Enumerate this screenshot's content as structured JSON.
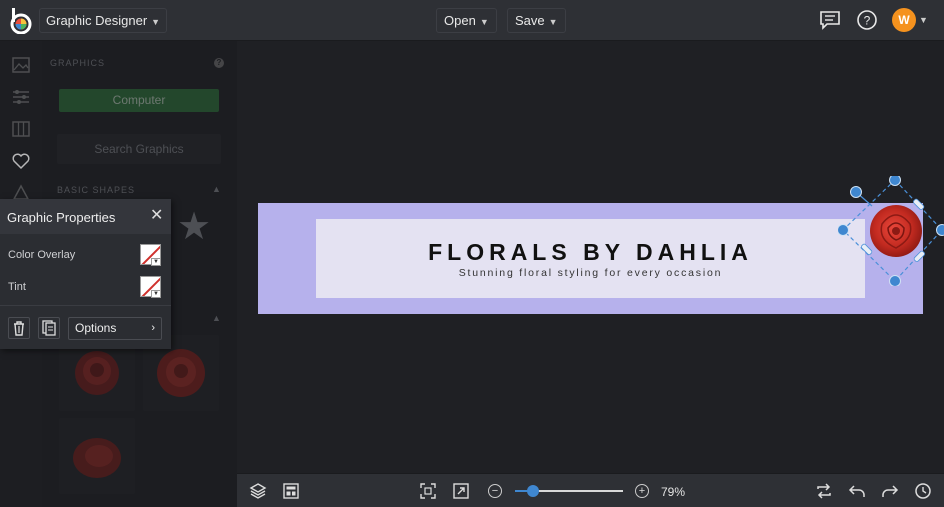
{
  "topbar": {
    "app_name": "Graphic Designer",
    "open_label": "Open",
    "save_label": "Save",
    "user_initial": "W"
  },
  "sidebar": {
    "section_title": "GRAPHICS",
    "computer_label": "Computer",
    "search_label": "Search Graphics",
    "shapes_header": "BASIC SHAPES"
  },
  "graphic_properties": {
    "title": "Graphic Properties",
    "color_overlay_label": "Color Overlay",
    "tint_label": "Tint",
    "options_label": "Options"
  },
  "canvas": {
    "banner_title": "FLORALS BY DAHLIA",
    "banner_subtitle": "Stunning floral styling for every occasion",
    "colors": {
      "background": "#b6b1ec",
      "banner": "#e4e2f2"
    }
  },
  "bottombar": {
    "zoom_label": "79%",
    "zoom_level": 0.17
  },
  "colors": {
    "accent": "#3f87d0",
    "avatar": "#f5921e",
    "computer_button": "#2c7a3a"
  }
}
